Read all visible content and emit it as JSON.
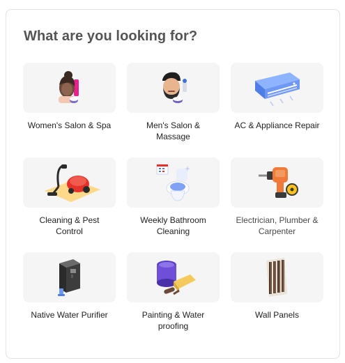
{
  "section": {
    "title": "What are you looking for?"
  },
  "services": [
    {
      "label": "Women's Salon & Spa",
      "icon": "woman-facial-icon"
    },
    {
      "label": "Men's Salon & Massage",
      "icon": "man-grooming-icon"
    },
    {
      "label": "AC & Appliance Repair",
      "icon": "air-conditioner-icon"
    },
    {
      "label": "Cleaning & Pest Control",
      "icon": "vacuum-cleaner-icon"
    },
    {
      "label": "Weekly Bathroom Cleaning",
      "icon": "toilet-icon"
    },
    {
      "label": "Electrician, Plumber & Carpenter",
      "icon": "drill-tools-icon"
    },
    {
      "label": "Native Water Purifier",
      "icon": "water-purifier-icon"
    },
    {
      "label": "Painting & Water proofing",
      "icon": "paint-bucket-roller-icon"
    },
    {
      "label": "Wall Panels",
      "icon": "wall-panel-icon"
    }
  ]
}
